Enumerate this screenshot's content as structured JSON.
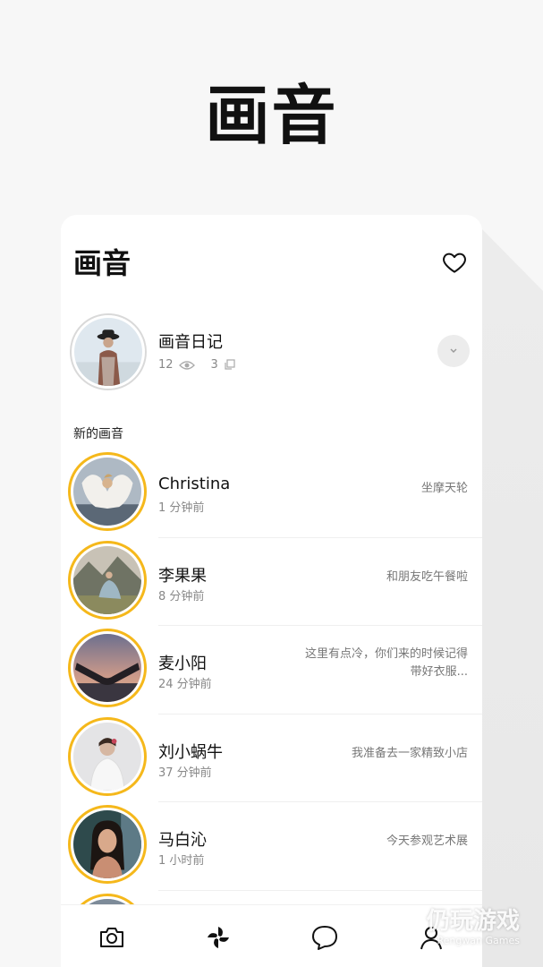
{
  "app": {
    "brand": "画音"
  },
  "header": {
    "brand": "画音",
    "favorites_icon": "heart-icon"
  },
  "profile": {
    "name": "画音日记",
    "views": "12",
    "copies": "3",
    "views_icon": "eye-icon",
    "copies_icon": "copy-icon",
    "expand_icon": "chevron-down-icon"
  },
  "section": {
    "title": "新的画音"
  },
  "feed": [
    {
      "name": "Christina",
      "time": "1 分钟前",
      "message": "坐摩天轮"
    },
    {
      "name": "李果果",
      "time": "8 分钟前",
      "message": "和朋友吃午餐啦"
    },
    {
      "name": "麦小阳",
      "time": "24 分钟前",
      "message": "这里有点冷，你们来的时候记得带好衣服..."
    },
    {
      "name": "刘小蜗牛",
      "time": "37 分钟前",
      "message": "我准备去一家精致小店"
    },
    {
      "name": "马白沁",
      "time": "1 小时前",
      "message": "今天参观艺术展"
    }
  ],
  "nav": {
    "items": [
      "camera-icon",
      "pinwheel-icon",
      "chat-icon",
      "user-icon"
    ]
  },
  "watermark": {
    "main": "仍玩游戏",
    "sub": "Rengwan Games"
  },
  "colors": {
    "ring": "#f5b81b",
    "background": "#f7f7f7",
    "text": "#111111"
  }
}
